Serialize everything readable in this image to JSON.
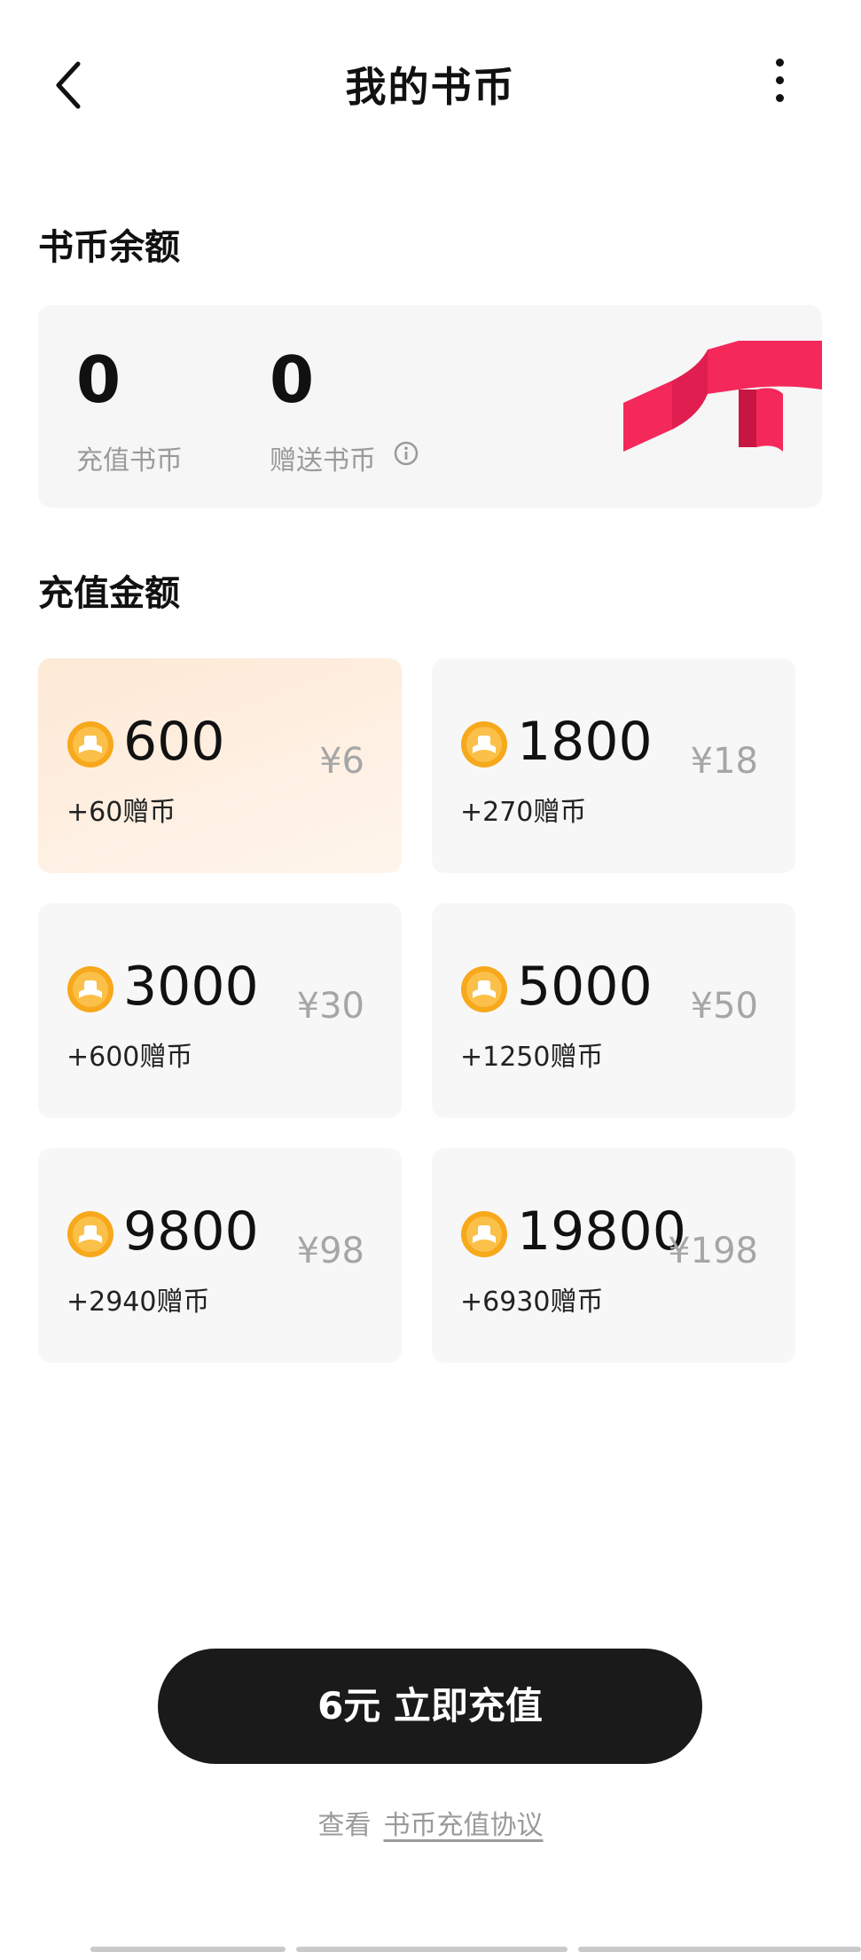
{
  "header": {
    "title": "我的书币",
    "back_icon": "chevron-left-icon",
    "more_icon": "more-vertical-icon"
  },
  "balance": {
    "section_title": "书币余额",
    "recharged_value": "0",
    "recharged_label": "充值书币",
    "gift_value": "0",
    "gift_label": "赠送书币",
    "info_icon": "info-icon",
    "ribbon_color": "#f4285b"
  },
  "recharge": {
    "section_title": "充值金额",
    "packages": [
      {
        "coins": "600",
        "bonus": "+60赠币",
        "price": "¥6",
        "selected": true
      },
      {
        "coins": "1800",
        "bonus": "+270赠币",
        "price": "¥18",
        "selected": false
      },
      {
        "coins": "3000",
        "bonus": "+600赠币",
        "price": "¥30",
        "selected": false
      },
      {
        "coins": "5000",
        "bonus": "+1250赠币",
        "price": "¥50",
        "selected": false
      },
      {
        "coins": "9800",
        "bonus": "+2940赠币",
        "price": "¥98",
        "selected": false
      },
      {
        "coins": "19800",
        "bonus": "+6930赠币",
        "price": "¥198",
        "selected": false
      }
    ]
  },
  "action": {
    "recharge_button": "6元 立即充值"
  },
  "agreement": {
    "prefix": "查看",
    "link": "书币充值协议"
  },
  "colors": {
    "coin": "#f7a81b",
    "selected_bg": "#fde9d6",
    "button_bg": "#1a1a1a",
    "accent_red": "#f4285b"
  }
}
